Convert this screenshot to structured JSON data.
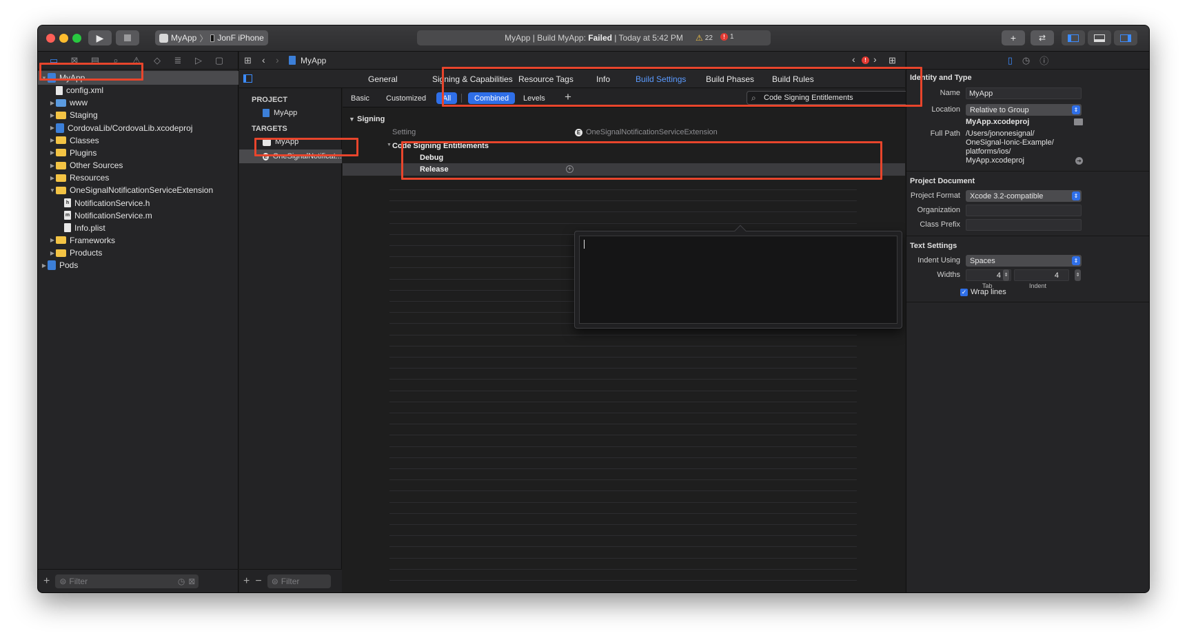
{
  "titlebar": {
    "scheme_target": "MyApp",
    "scheme_device": "JonF iPhone",
    "activity_prefix": "MyApp | Build MyApp:",
    "activity_status": "Failed",
    "activity_suffix": "| Today at 5:42 PM",
    "warnings": "22",
    "errors": "1"
  },
  "navigator": {
    "tree": [
      {
        "label": "MyApp",
        "level": 0,
        "kind": "project",
        "expanded": true,
        "selected": true
      },
      {
        "label": "config.xml",
        "level": 1,
        "kind": "file"
      },
      {
        "label": "www",
        "level": 1,
        "kind": "folder-blue",
        "collapsed": true
      },
      {
        "label": "Staging",
        "level": 1,
        "kind": "folder",
        "collapsed": true
      },
      {
        "label": "CordovaLib/CordovaLib.xcodeproj",
        "level": 1,
        "kind": "project",
        "collapsed": true
      },
      {
        "label": "Classes",
        "level": 1,
        "kind": "folder",
        "collapsed": true
      },
      {
        "label": "Plugins",
        "level": 1,
        "kind": "folder",
        "collapsed": true
      },
      {
        "label": "Other Sources",
        "level": 1,
        "kind": "folder",
        "collapsed": true
      },
      {
        "label": "Resources",
        "level": 1,
        "kind": "folder",
        "collapsed": true
      },
      {
        "label": "OneSignalNotificationServiceExtension",
        "level": 1,
        "kind": "folder",
        "expanded": true
      },
      {
        "label": "NotificationService.h",
        "level": 2,
        "kind": "file-h"
      },
      {
        "label": "NotificationService.m",
        "level": 2,
        "kind": "file-m"
      },
      {
        "label": "Info.plist",
        "level": 2,
        "kind": "file"
      },
      {
        "label": "Frameworks",
        "level": 1,
        "kind": "folder",
        "collapsed": true
      },
      {
        "label": "Products",
        "level": 1,
        "kind": "folder",
        "collapsed": true
      },
      {
        "label": "Pods",
        "level": 0,
        "kind": "project",
        "collapsed": true
      }
    ],
    "filter_placeholder": "Filter"
  },
  "editor": {
    "breadcrumb": "MyApp",
    "tabs": [
      "General",
      "Signing & Capabilities",
      "Resource Tags",
      "Info",
      "Build Settings",
      "Build Phases",
      "Build Rules"
    ],
    "active_tab": "Build Settings",
    "project_header": "PROJECT",
    "project_item": "MyApp",
    "targets_header": "TARGETS",
    "targets": [
      "MyApp",
      "OneSignalNotificat..."
    ],
    "filter_buttons": [
      "Basic",
      "Customized",
      "All",
      "Combined",
      "Levels"
    ],
    "search_value": "Code Signing Entitlements",
    "section_title": "Signing",
    "column_setting": "Setting",
    "column_target": "OneSignalNotificationServiceExtension",
    "setting_name": "Code Signing Entitlements",
    "setting_children": [
      "Debug",
      "Release"
    ],
    "filter_placeholder": "Filter"
  },
  "inspector": {
    "identity_header": "Identity and Type",
    "name_label": "Name",
    "name_value": "MyApp",
    "location_label": "Location",
    "location_value": "Relative to Group",
    "location_file": "MyApp.xcodeproj",
    "fullpath_label": "Full Path",
    "fullpath_lines": [
      "/Users/jononesignal/",
      "OneSignal-Ionic-Example/",
      "platforms/ios/",
      "MyApp.xcodeproj"
    ],
    "project_doc_header": "Project Document",
    "format_label": "Project Format",
    "format_value": "Xcode 3.2-compatible",
    "org_label": "Organization",
    "org_value": "",
    "prefix_label": "Class Prefix",
    "prefix_value": "",
    "text_header": "Text Settings",
    "indent_label": "Indent Using",
    "indent_value": "Spaces",
    "widths_label": "Widths",
    "tab_value": "4",
    "indent_width_value": "4",
    "tab_caption": "Tab",
    "indent_caption": "Indent",
    "wrap_label": "Wrap lines",
    "wrap_checked": true
  },
  "colors": {
    "accent": "#2f6fe8",
    "active_tab": "#5b9bff",
    "highlight_box": "#e8452c",
    "window_bg": "#1e1e1e"
  }
}
